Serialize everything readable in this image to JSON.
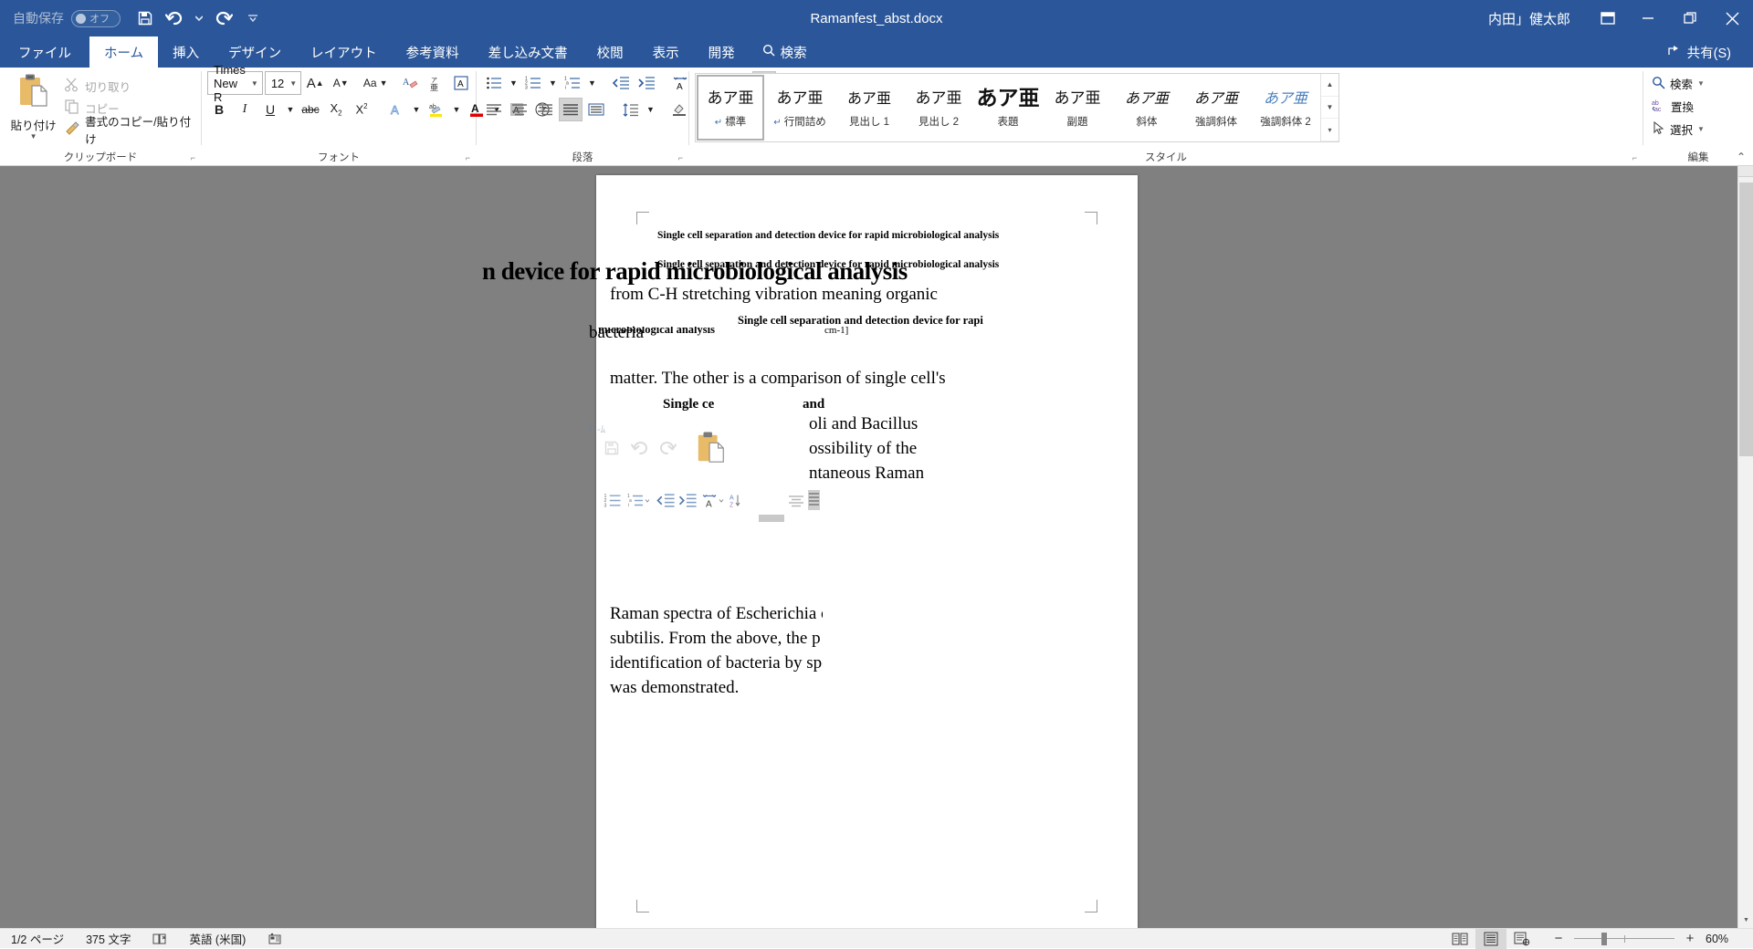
{
  "titlebar": {
    "autosave_label": "自動保存",
    "autosave_state": "オフ",
    "document_title": "Ramanfest_abst.docx",
    "user_name": "内田」健太郎",
    "save_icon": "save-icon",
    "undo_icon": "undo-icon",
    "redo_icon": "redo-icon",
    "customize_qat_icon": "customize-quick-access-toolbar-icon",
    "ribbon_display_icon": "ribbon-display-options-icon",
    "minimize_icon": "minimize-icon",
    "restore_icon": "restore-icon",
    "close_icon": "close-icon"
  },
  "tabs": [
    {
      "label": "ファイル",
      "active": false
    },
    {
      "label": "ホーム",
      "active": true
    },
    {
      "label": "挿入",
      "active": false
    },
    {
      "label": "デザイン",
      "active": false
    },
    {
      "label": "レイアウト",
      "active": false
    },
    {
      "label": "参考資料",
      "active": false
    },
    {
      "label": "差し込み文書",
      "active": false
    },
    {
      "label": "校閲",
      "active": false
    },
    {
      "label": "表示",
      "active": false
    },
    {
      "label": "開発",
      "active": false
    }
  ],
  "tab_search": {
    "label": "検索",
    "icon": "search-icon"
  },
  "share": {
    "label": "共有(S)",
    "icon": "share-icon"
  },
  "ribbon": {
    "clipboard": {
      "group_label": "クリップボード",
      "paste_label": "貼り付け",
      "items": [
        {
          "label": "切り取り",
          "icon": "scissors-icon",
          "enabled": false
        },
        {
          "label": "コピー",
          "icon": "copy-icon",
          "enabled": false
        },
        {
          "label": "書式のコピー/貼り付け",
          "icon": "format-painter-icon",
          "enabled": true
        }
      ]
    },
    "font": {
      "group_label": "フォント",
      "font_name": "Times New R",
      "font_size": "12",
      "buttons_row1": [
        {
          "name": "grow-font-button",
          "glyph": "A"
        },
        {
          "name": "shrink-font-button",
          "glyph": "A"
        },
        {
          "name": "change-case-button",
          "glyph": "Aa"
        },
        {
          "name": "clear-formatting-button",
          "glyph": "A"
        },
        {
          "name": "phonetic-guide-button",
          "glyph": "ア"
        },
        {
          "name": "character-border-button",
          "glyph": "A"
        }
      ],
      "buttons_row2": [
        {
          "name": "bold-button",
          "glyph": "B"
        },
        {
          "name": "italic-button",
          "glyph": "I"
        },
        {
          "name": "underline-button",
          "glyph": "U"
        },
        {
          "name": "strikethrough-button",
          "glyph": "abc"
        },
        {
          "name": "subscript-button",
          "glyph": "X2"
        },
        {
          "name": "superscript-button",
          "glyph": "X2"
        },
        {
          "name": "text-effects-button",
          "glyph": "A"
        },
        {
          "name": "text-highlight-color-button",
          "glyph": "ab"
        },
        {
          "name": "font-color-button",
          "glyph": "A"
        },
        {
          "name": "character-shading-button",
          "glyph": "A"
        },
        {
          "name": "enclose-characters-button",
          "glyph": "字"
        }
      ]
    },
    "paragraph": {
      "group_label": "段落",
      "buttons_row1": [
        {
          "name": "bullets-button"
        },
        {
          "name": "numbering-button"
        },
        {
          "name": "multilevel-list-button"
        },
        {
          "name": "decrease-indent-button"
        },
        {
          "name": "increase-indent-button"
        },
        {
          "name": "asian-layout-button"
        },
        {
          "name": "sort-button"
        },
        {
          "name": "show-formatting-marks-button"
        }
      ],
      "buttons_row2": [
        {
          "name": "align-left-button"
        },
        {
          "name": "align-center-button"
        },
        {
          "name": "align-right-button"
        },
        {
          "name": "justify-button"
        },
        {
          "name": "distribute-button"
        },
        {
          "name": "line-spacing-button"
        },
        {
          "name": "shading-button"
        },
        {
          "name": "borders-button"
        }
      ]
    },
    "styles": {
      "group_label": "スタイル",
      "preview_glyph": "あア亜",
      "items": [
        {
          "name": "標準",
          "paragraph_mark": true,
          "variant": "normal"
        },
        {
          "name": "行間詰め",
          "paragraph_mark": true,
          "variant": "normal"
        },
        {
          "name": "見出し 1",
          "paragraph_mark": false,
          "variant": "h1"
        },
        {
          "name": "見出し 2",
          "paragraph_mark": false,
          "variant": "normal"
        },
        {
          "name": "表題",
          "paragraph_mark": false,
          "variant": "big"
        },
        {
          "name": "副題",
          "paragraph_mark": false,
          "variant": "normal"
        },
        {
          "name": "斜体",
          "paragraph_mark": false,
          "variant": "ital"
        },
        {
          "name": "強調斜体",
          "paragraph_mark": false,
          "variant": "ital"
        },
        {
          "name": "強調斜体 2",
          "paragraph_mark": false,
          "variant": "blue"
        }
      ],
      "selected_index": 0
    },
    "editing": {
      "group_label": "編集",
      "items": [
        {
          "label": "検索",
          "icon": "search-icon",
          "has_caret": true
        },
        {
          "label": "置換",
          "icon": "replace-icon",
          "has_caret": false
        },
        {
          "label": "選択",
          "icon": "select-pointer-icon",
          "has_caret": true
        }
      ]
    },
    "collapse_icon": "collapse-ribbon-icon"
  },
  "document": {
    "header_line_1": "Single cell separation and detection device for rapid microbiological analysis",
    "header_line_2": "Single cell separation and detection device for rapid microbiological analysis",
    "glitch_title_fragment": "n device for rapid microbiological analysis",
    "body_line_1": "from C-H stretching vibration meaning organic",
    "ghost_line_1": "Single cell separation and detection device for rapi",
    "ghost_line_2": "d microbiological analysis",
    "ghost_fragment_cm": "cm-1]",
    "body_line_2": "bacteria",
    "body_line_3": "matter. The other is a comparison of single cell's",
    "bold_fragment_left": "Single ce",
    "bold_fragment_right": "and",
    "body_line_4": "oli and Bacillus",
    "body_line_5": "ossibility of the",
    "body_line_6": "ntaneous Raman",
    "body_line_7": "Raman spectra of Escherichia c",
    "body_line_8": "subtilis. From the above, the p",
    "body_line_9": "identification of bacteria by spo",
    "body_line_10": "was demonstrated."
  },
  "statusbar": {
    "page_info": "1/2 ページ",
    "word_count": "375 文字",
    "proofing_icon": "proofing-errors-icon",
    "language": "英語 (米国)",
    "macro_icon": "macro-recording-icon",
    "views": [
      {
        "name": "read-mode-view-button",
        "active": false
      },
      {
        "name": "print-layout-view-button",
        "active": true
      },
      {
        "name": "web-layout-view-button",
        "active": false
      }
    ],
    "zoom_out_glyph": "−",
    "zoom_in_glyph": "+",
    "zoom_level": "60%"
  },
  "colors": {
    "word_blue": "#2b579a",
    "doc_background": "#808080",
    "accent_orange": "#e8bb68"
  }
}
